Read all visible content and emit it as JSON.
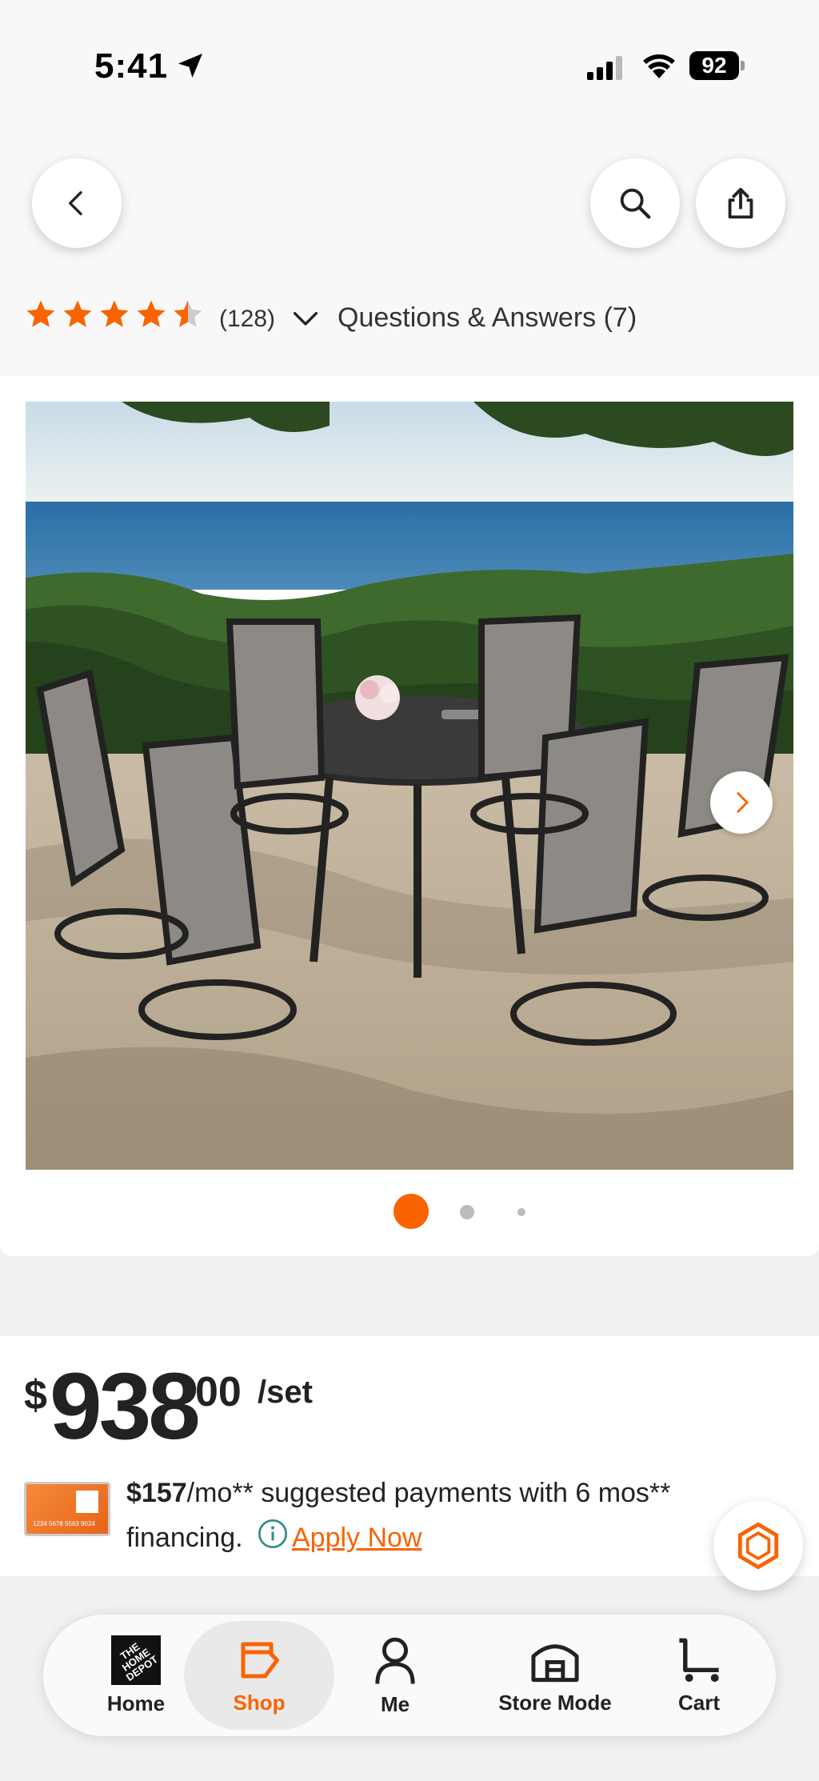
{
  "status_bar": {
    "time": "5:41",
    "battery": "92"
  },
  "header": {
    "back_icon": "chevron-left-icon",
    "search_icon": "search-icon",
    "share_icon": "share-icon"
  },
  "rating": {
    "stars": 4.5,
    "max_stars": 5,
    "count_label": "(128)",
    "qa_label": "Questions & Answers (7)"
  },
  "gallery": {
    "image_alt": "Patio dining set with round table and six swivel chairs overlooking the ocean",
    "page_count": 3,
    "current_page": 1
  },
  "price": {
    "currency": "$",
    "whole": "938",
    "cents": "00",
    "unit": "/set"
  },
  "financing": {
    "amount": "$157",
    "text_after_amount": "/mo** suggested payments with 6 mos** financing.",
    "apply_label": "Apply Now"
  },
  "bottom_nav": {
    "items": [
      {
        "label": "Home"
      },
      {
        "label": "Shop"
      },
      {
        "label": "Me"
      },
      {
        "label": "Store Mode"
      },
      {
        "label": "Cart"
      }
    ],
    "logo_text": "THE HOME DEPOT"
  },
  "colors": {
    "accent": "#f96302",
    "star": "#f96302"
  }
}
